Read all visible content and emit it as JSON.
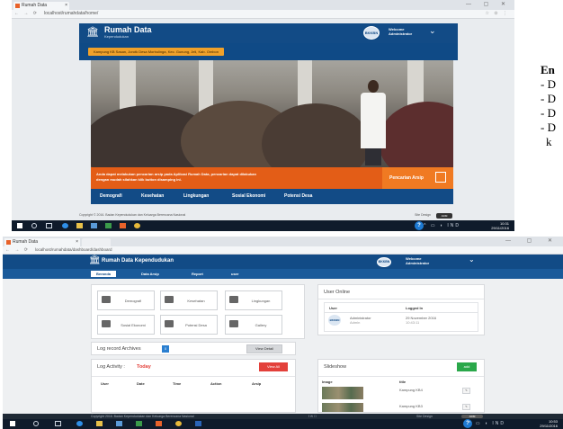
{
  "shot1": {
    "tab_title": "Rumah Data",
    "url": "localhost/rumahdata/home/",
    "brand_title": "Rumah Data",
    "brand_subtitle": "Kependudukan",
    "welcome_label": "Welcome",
    "user_name": "Administrator",
    "location_pill": "Kampung KB Sasan, Jorotk Desa Morbulinga, Kec. Gunung, Jeli, Kab. Ombon",
    "overlay_line1": "Anda dapat melakukan pencarian arsip pada Aplikasi Rumah Data, pencarian dapat dilakukan",
    "overlay_line2": "dengan mudah silahkan klik button disamping ini.",
    "search_button": "Pencarian Arsip",
    "menu": [
      "Demografi",
      "Kesehatan",
      "Lingkungan",
      "Sosial Ekonomi",
      "Potensi Desa"
    ],
    "footer_text": "Copyright © 2016. Badan Kependudukan dan Keluarga Berencana Nasional",
    "footer_right": "Site Design",
    "footer_btn": "ADM",
    "clock_time": "10:31",
    "clock_date": "29/11/2016",
    "lang": "IND"
  },
  "side_list": {
    "title": "En",
    "items": [
      "- D",
      "- D",
      "- D",
      "- D",
      "  k"
    ]
  },
  "shot2": {
    "tab_title": "Rumah Data",
    "url": "localhost/rumahdata/dashboard/dashboard",
    "brand_title": "Rumah Data Kependudukan",
    "welcome_label": "Welcome",
    "user_name": "Administrator",
    "nav": [
      "Beranda",
      "Data Arsip",
      "Report",
      "user"
    ],
    "tiles": [
      "Demografi",
      "Kesehatan",
      "Lingkungan",
      "Sosial Ekonomi",
      "Potensi Desa",
      "Gallery"
    ],
    "log_archives": {
      "title": "Log record Archives",
      "count": "0",
      "button": "View Detail"
    },
    "log_activity": {
      "title": "Log Activity :",
      "today": "Today",
      "button": "View All",
      "columns": [
        "User",
        "Date",
        "Time",
        "Action",
        "Arsip"
      ]
    },
    "user_online": {
      "title": "User Online",
      "columns": [
        "User",
        "Logged In"
      ],
      "row": {
        "name": "Administrator",
        "role": "Admin",
        "date": "29 November 2016",
        "time": "10:43:11"
      }
    },
    "slideshow": {
      "title": "Slideshow",
      "add_button": "add",
      "columns": [
        "Image",
        "title"
      ],
      "rows": [
        {
          "title": "Kampung KB4"
        },
        {
          "title": "Kampung KB3"
        }
      ]
    },
    "footer_text": "Copyright 2016. Badan Kependudukan dan Keluarga Berencana Nasional",
    "footer_right": "Site Design",
    "footer_btn": "ADM",
    "clock_time": "10:53",
    "clock_date": "29/11/2016",
    "lang": "IND"
  }
}
